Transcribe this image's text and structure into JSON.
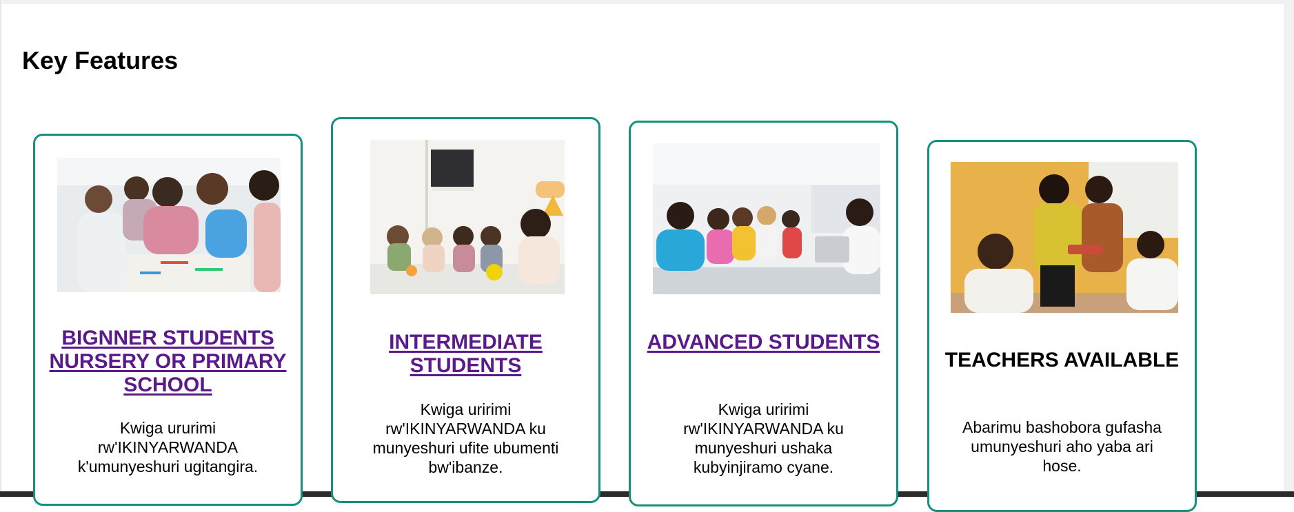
{
  "heading": "Key Features",
  "cards": [
    {
      "title": "BIGNNER STUDENTS NURSERY OR PRIMARY SCHOOL",
      "description": "Kwiga ururimi rw'IKINYARWANDA k'umunyeshuri ugitangira.",
      "is_link": true
    },
    {
      "title": "INTERMEDIATE STUDENTS",
      "description": "Kwiga uririmi rw'IKINYARWANDA ku munyeshuri ufite ubumenti bw'ibanze.",
      "is_link": true
    },
    {
      "title": "ADVANCED STUDENTS",
      "description": "Kwiga uririmi rw'IKINYARWANDA ku munyeshuri ushaka kubyinjiramo cyane.",
      "is_link": true
    },
    {
      "title": "TEACHERS AVAILABLE",
      "description": "Abarimu bashobora gufasha umunyeshuri aho yaba ari hose.",
      "is_link": false
    }
  ],
  "colors": {
    "card_border": "#14907f",
    "link": "#5a1a8c"
  }
}
